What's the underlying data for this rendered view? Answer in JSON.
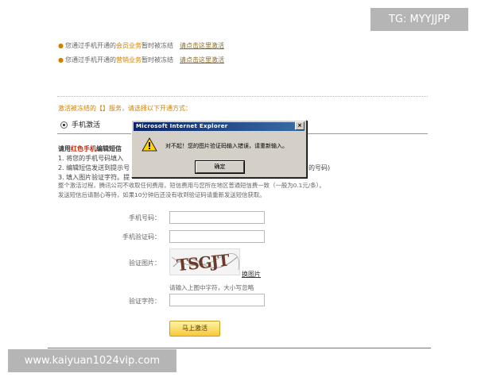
{
  "watermarks": {
    "top_right": "TG: MYYJJPP",
    "bottom_left": "www.kaiyuan1024vip.com"
  },
  "notices": [
    {
      "pre": "您通过手机开通的",
      "highlight": "会员业务",
      "post": "暂时被冻结",
      "link": "请点击这里激活"
    },
    {
      "pre": "您通过手机开通的",
      "highlight": "营销业务",
      "post": "暂时被冻结",
      "link": "请点击这里激活"
    }
  ],
  "section_title": "激活被冻结的【】服务，请选择以下开通方式：",
  "radio_label": "手机激活",
  "instructions": {
    "lead_pre": "请用",
    "lead_red": "红色手机",
    "lead_post": "编辑短信",
    "step1": "1. 将您的手机号码填入",
    "step2": "2. 编辑短信发送到提示号",
    "step2_tail": "的号码)",
    "step3": "3. 填入图片验证字符。提",
    "note1": "整个激活过程，腾讯公司不收取任何费用，短信费用与您所在地区普通短信费一致（一般为0.1元/条）。",
    "note2": "发送短信后请耐心等待，如果10分钟后还没有收到验证码请重新发送短信获取。"
  },
  "form": {
    "phone_label": "手机号码：",
    "code_label": "手机验证码：",
    "image_label": "验证图片：",
    "captcha_text": "TSGJT",
    "refresh_link": "换图片",
    "hint": "请输入上图中字符，大小写忽略",
    "chars_label": "验证字符：",
    "submit": "马上激活"
  },
  "dialog": {
    "title": "Microsoft Internet Explorer",
    "close": "×",
    "message": "对不起！您的图片验证码输入错误，请重新输入。",
    "ok": "确定"
  }
}
